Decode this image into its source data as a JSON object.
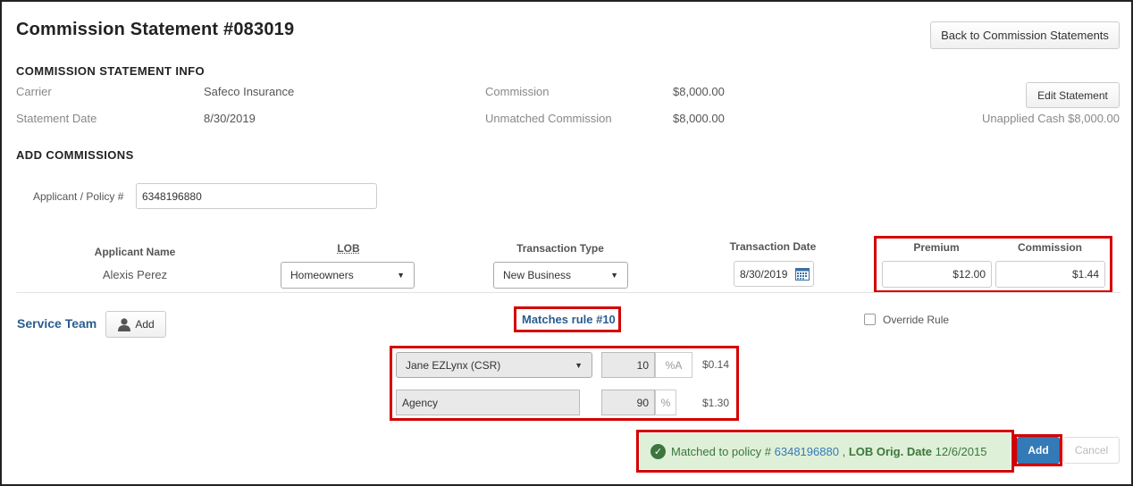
{
  "header": {
    "title": "Commission Statement #083019",
    "back_button": "Back to Commission Statements"
  },
  "info": {
    "section_title": "COMMISSION STATEMENT INFO",
    "carrier_label": "Carrier",
    "carrier_value": "Safeco Insurance",
    "statement_date_label": "Statement Date",
    "statement_date_value": "8/30/2019",
    "commission_label": "Commission",
    "commission_value": "$8,000.00",
    "unmatched_label": "Unmatched Commission",
    "unmatched_value": "$8,000.00",
    "edit_button": "Edit Statement",
    "unapplied_cash": "Unapplied Cash $8,000.00"
  },
  "add": {
    "section_title": "ADD COMMISSIONS",
    "applicant_policy_label": "Applicant / Policy #",
    "applicant_policy_value": "6348196880",
    "columns": {
      "applicant_name": "Applicant Name",
      "lob": "LOB",
      "transaction_type": "Transaction Type",
      "transaction_date": "Transaction Date",
      "premium": "Premium",
      "commission": "Commission"
    },
    "row": {
      "applicant_name": "Alexis Perez",
      "lob": "Homeowners",
      "transaction_type": "New Business",
      "transaction_date": "8/30/2019",
      "premium": "$12.00",
      "commission": "$1.44"
    }
  },
  "service": {
    "title": "Service Team",
    "add_button": "Add",
    "matches_rule": "Matches rule #10",
    "override_label": "Override Rule",
    "splits": [
      {
        "name": "Jane EZLynx (CSR)",
        "percent": "10",
        "unit": "%A",
        "amount": "$0.14"
      },
      {
        "name": "Agency",
        "percent": "90",
        "unit": "%",
        "amount": "$1.30"
      }
    ]
  },
  "footer": {
    "matched_prefix": "Matched to policy #",
    "policy_link": "6348196880",
    "separator": ",",
    "lob_label": "LOB Orig. Date",
    "lob_date": "12/6/2015",
    "add_button": "Add",
    "cancel_button": "Cancel"
  },
  "colors": {
    "highlight": "#d40000",
    "primary": "#337ab7",
    "success_bg": "#dff0d8",
    "success_text": "#3c763d"
  }
}
